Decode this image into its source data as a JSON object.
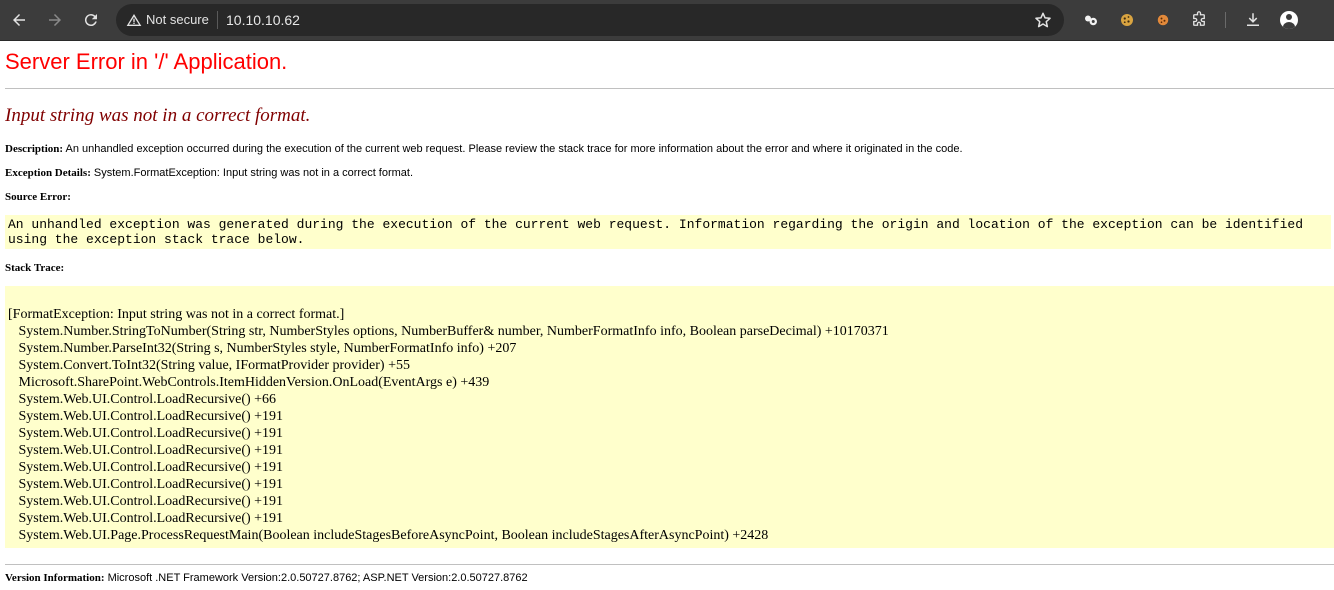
{
  "browser": {
    "security_label": "Not secure",
    "url": "10.10.10.62",
    "icons": [
      "back-arrow-icon",
      "forward-arrow-icon",
      "reload-icon",
      "warning-icon",
      "star-icon",
      "extension-icon",
      "cookie-icon",
      "cookie-icon",
      "puzzle-icon",
      "download-icon",
      "profile-icon"
    ]
  },
  "page": {
    "title": "Server Error in '/' Application.",
    "error_message": "Input string was not in a correct format.",
    "description_label": "Description:",
    "description_text": " An unhandled exception occurred during the execution of the current web request. Please review the stack trace for more information about the error and where it originated in the code.",
    "exception_label": "Exception Details:",
    "exception_text": " System.FormatException: Input string was not in a correct format.",
    "source_error_label": "Source Error:",
    "source_error_text": "An unhandled exception was generated during the execution of the current web request. Information regarding the origin and location of the exception can be identified using the exception stack trace below.",
    "stack_trace_label": "Stack Trace:",
    "stack_trace": [
      "[FormatException: Input string was not in a correct format.]",
      "   System.Number.StringToNumber(String str, NumberStyles options, NumberBuffer& number, NumberFormatInfo info, Boolean parseDecimal) +10170371",
      "   System.Number.ParseInt32(String s, NumberStyles style, NumberFormatInfo info) +207",
      "   System.Convert.ToInt32(String value, IFormatProvider provider) +55",
      "   Microsoft.SharePoint.WebControls.ItemHiddenVersion.OnLoad(EventArgs e) +439",
      "   System.Web.UI.Control.LoadRecursive() +66",
      "   System.Web.UI.Control.LoadRecursive() +191",
      "   System.Web.UI.Control.LoadRecursive() +191",
      "   System.Web.UI.Control.LoadRecursive() +191",
      "   System.Web.UI.Control.LoadRecursive() +191",
      "   System.Web.UI.Control.LoadRecursive() +191",
      "   System.Web.UI.Control.LoadRecursive() +191",
      "   System.Web.UI.Control.LoadRecursive() +191",
      "   System.Web.UI.Page.ProcessRequestMain(Boolean includeStagesBeforeAsyncPoint, Boolean includeStagesAfterAsyncPoint) +2428"
    ],
    "version_label": "Version Information:",
    "version_text": " Microsoft .NET Framework Version:2.0.50727.8762; ASP.NET Version:2.0.50727.8762"
  },
  "colors": {
    "title_red": "#ff0000",
    "error_maroon": "#800000",
    "code_bg": "#ffffcc",
    "chrome_bg": "#3c3c3c"
  }
}
